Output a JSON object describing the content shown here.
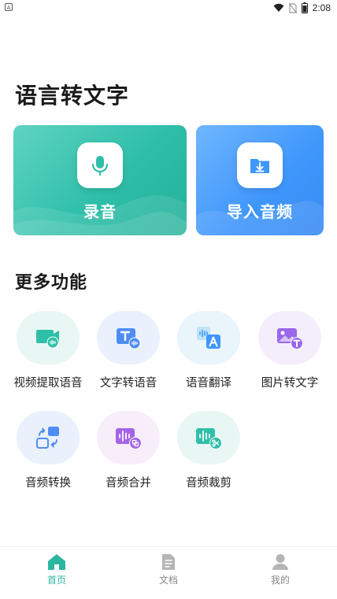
{
  "status_bar": {
    "notification_icon": "A",
    "time": "2:08",
    "icons": [
      "wifi-icon",
      "no-sim-icon",
      "battery-icon"
    ]
  },
  "page_title": "语言转文字",
  "cards": [
    {
      "label": "录音",
      "icon": "microphone-icon",
      "color": "#2fbfa9"
    },
    {
      "label": "导入音频",
      "icon": "folder-import-icon",
      "color": "#3f96fb"
    }
  ],
  "more_section": {
    "title": "更多功能"
  },
  "features": [
    {
      "label": "视频提取语音",
      "icon": "video-to-audio-icon"
    },
    {
      "label": "文字转语音",
      "icon": "text-to-speech-icon"
    },
    {
      "label": "语音翻译",
      "icon": "voice-translate-icon"
    },
    {
      "label": "图片转文字",
      "icon": "image-to-text-icon"
    },
    {
      "label": "音频转换",
      "icon": "audio-convert-icon"
    },
    {
      "label": "音频合并",
      "icon": "audio-merge-icon"
    },
    {
      "label": "音频裁剪",
      "icon": "audio-cut-icon"
    }
  ],
  "bottom_nav": [
    {
      "label": "首页",
      "icon": "home-icon",
      "active": true
    },
    {
      "label": "文档",
      "icon": "document-icon",
      "active": false
    },
    {
      "label": "我的",
      "icon": "profile-icon",
      "active": false
    }
  ],
  "colors": {
    "accent": "#2cb5a0",
    "inactive": "#b5b5b5"
  }
}
